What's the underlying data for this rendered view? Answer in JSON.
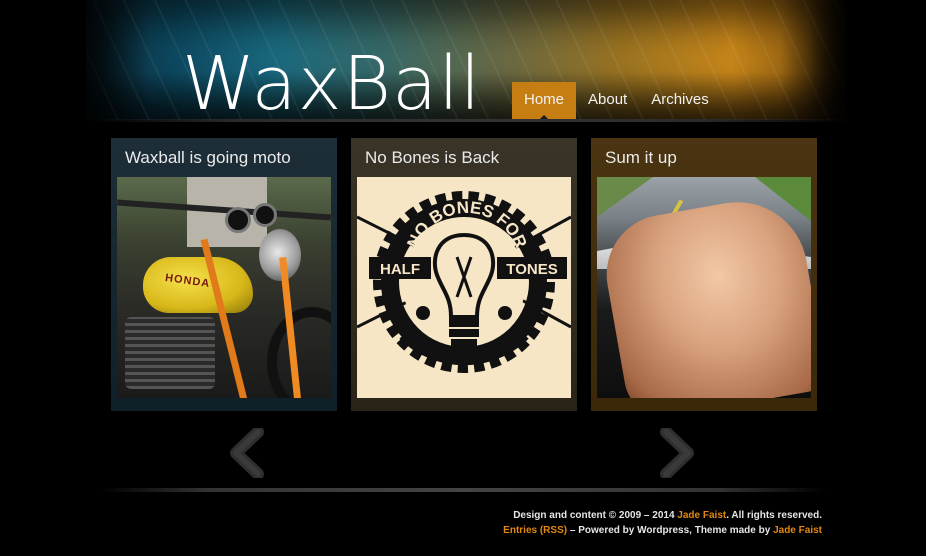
{
  "site": {
    "logo": "WaxBall"
  },
  "nav": {
    "items": [
      {
        "label": "Home",
        "active": true
      },
      {
        "label": "About",
        "active": false
      },
      {
        "label": "Archives",
        "active": false
      }
    ]
  },
  "posts": [
    {
      "title": "Waxball is going moto",
      "image": "motorcycle-photo"
    },
    {
      "title": "No Bones is Back",
      "image": "no-bones-logo"
    },
    {
      "title": "Sum it up",
      "image": "driving-hand-photo"
    }
  ],
  "poster": {
    "top_text": "NO BONES FOR",
    "left_text": "HALF",
    "right_text": "TONES"
  },
  "photo_text": {
    "tank": "HONDA"
  },
  "pager": {
    "prev_icon": "chevron-left-icon",
    "next_icon": "chevron-right-icon"
  },
  "footer": {
    "line1_prefix": "Design and content © 2009 – 2014",
    "line1_author": "Jade Faist",
    "line1_suffix": ". All rights reserved.",
    "line2_rss": "Entries (RSS)",
    "line2_middle": " – Powered by Wordpress, Theme made by ",
    "line2_author": "Jade Faist"
  },
  "colors": {
    "accent": "#c67d12",
    "link": "#e2870f",
    "background": "#000000"
  }
}
